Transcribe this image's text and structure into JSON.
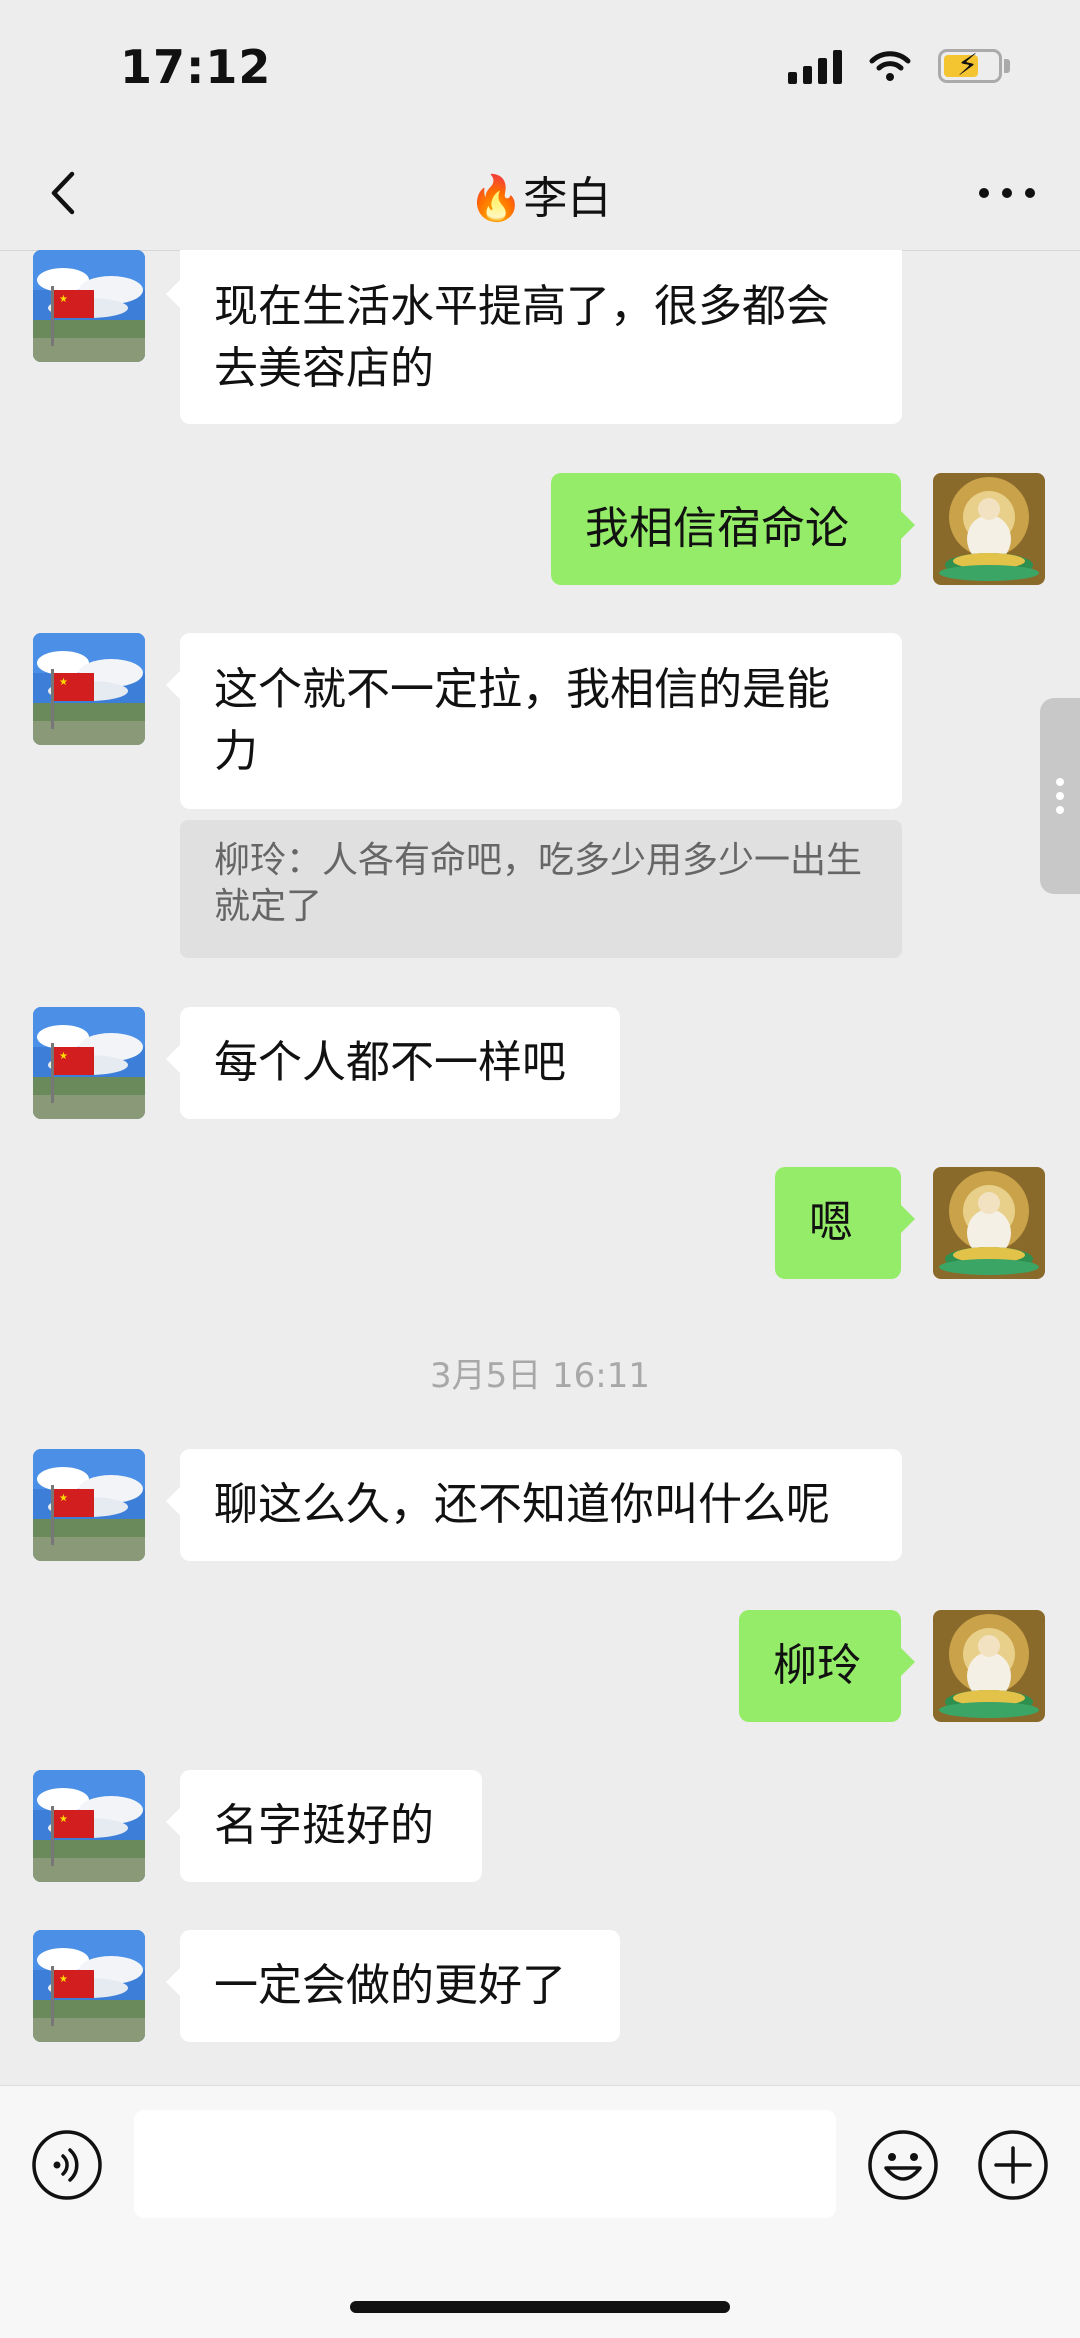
{
  "status_bar": {
    "time": "17:12"
  },
  "header": {
    "title": "🔥李白"
  },
  "messages": [
    {
      "side": "left",
      "text": "现在生活水平提高了，很多都会去美容店的"
    },
    {
      "side": "right",
      "text": "我相信宿命论"
    },
    {
      "side": "left",
      "text": "这个就不一定拉，我相信的是能力",
      "quote": "柳玲：人各有命吧，吃多少用多少一出生就定了"
    },
    {
      "side": "left",
      "text": "每个人都不一样吧"
    },
    {
      "side": "right",
      "text": "嗯"
    },
    {
      "side": "left",
      "text": "聊这么久，还不知道你叫什么呢"
    },
    {
      "side": "right",
      "text": "柳玲"
    },
    {
      "side": "left",
      "text": "名字挺好的"
    },
    {
      "side": "left",
      "text": "一定会做的更好了"
    }
  ],
  "timestamps": [
    "3月5日 16:11"
  ],
  "input_bar": {
    "placeholder": ""
  },
  "colors": {
    "background": "#ededed",
    "sent_bubble": "#95ec69",
    "received_bubble": "#ffffff"
  },
  "icons": [
    "back-icon",
    "more-icon",
    "voice-icon",
    "emoji-icon",
    "plus-icon"
  ]
}
